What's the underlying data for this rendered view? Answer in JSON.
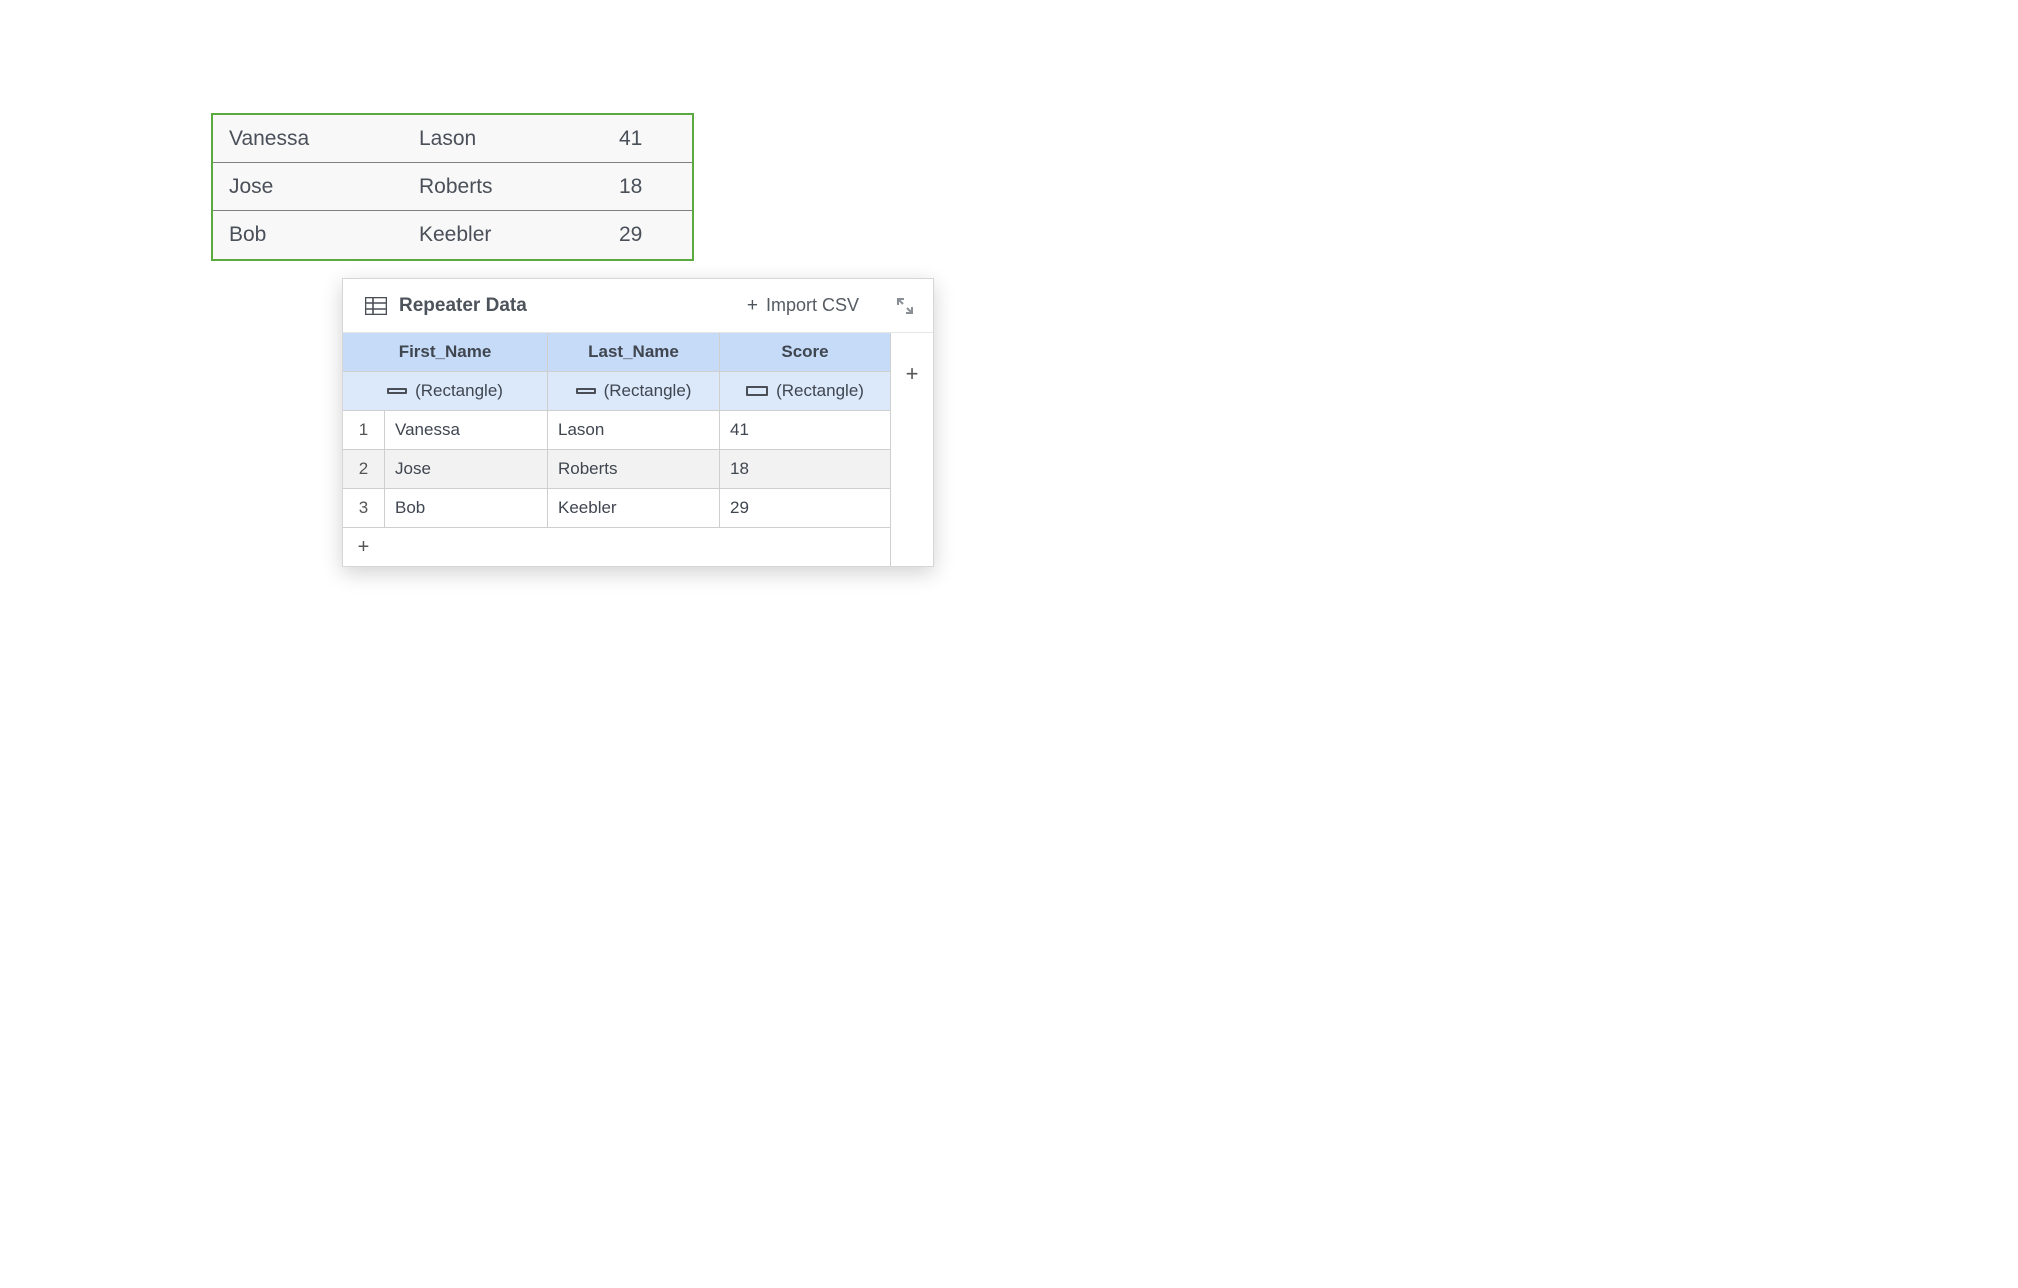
{
  "canvas_repeater": {
    "rows": [
      {
        "first": "Vanessa",
        "last": "Lason",
        "score": "41"
      },
      {
        "first": "Jose",
        "last": "Roberts",
        "score": "18"
      },
      {
        "first": "Bob",
        "last": "Keebler",
        "score": "29"
      }
    ]
  },
  "panel": {
    "title": "Repeater Data",
    "import_label": "Import CSV",
    "columns": {
      "c1": {
        "name": "First_Name",
        "widget": "(Rectangle)"
      },
      "c2": {
        "name": "Last_Name",
        "widget": "(Rectangle)"
      },
      "c3": {
        "name": "Score",
        "widget": "(Rectangle)"
      }
    },
    "rows": [
      {
        "idx": "1",
        "c1": "Vanessa",
        "c2": "Lason",
        "c3": "41"
      },
      {
        "idx": "2",
        "c1": "Jose",
        "c2": "Roberts",
        "c3": "18"
      },
      {
        "idx": "3",
        "c1": "Bob",
        "c2": "Keebler",
        "c3": "29"
      }
    ],
    "add_row_glyph": "+",
    "add_col_glyph": "+",
    "import_plus": "+"
  }
}
